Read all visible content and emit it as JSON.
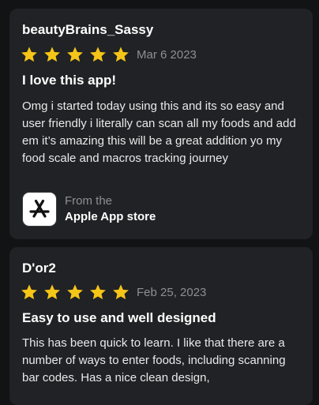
{
  "reviews": [
    {
      "author": "beautyBrains_Sassy",
      "rating": 5,
      "rating_max": 5,
      "date": "Mar 6 2023",
      "title": "I love this app!",
      "body": "Omg i started today using this and its so easy and user friendly i literally can scan all my foods and add em it’s amazing this will be a great addition yo my food scale and macros tracking journey",
      "source": {
        "from_label": "From the",
        "store_label": "Apple App store",
        "icon": "app-store-icon"
      }
    },
    {
      "author": "D'or2",
      "rating": 5,
      "rating_max": 5,
      "date": "Feb 25, 2023",
      "title": "Easy to use and well designed",
      "body": "This has been quick to learn. I like that there are a number of ways to enter foods, including scanning bar codes. Has a nice clean design,"
    }
  ],
  "colors": {
    "star": "#f5c518",
    "card_background": "#202225",
    "page_background": "#121314",
    "secondary_text": "#8e8f93"
  }
}
